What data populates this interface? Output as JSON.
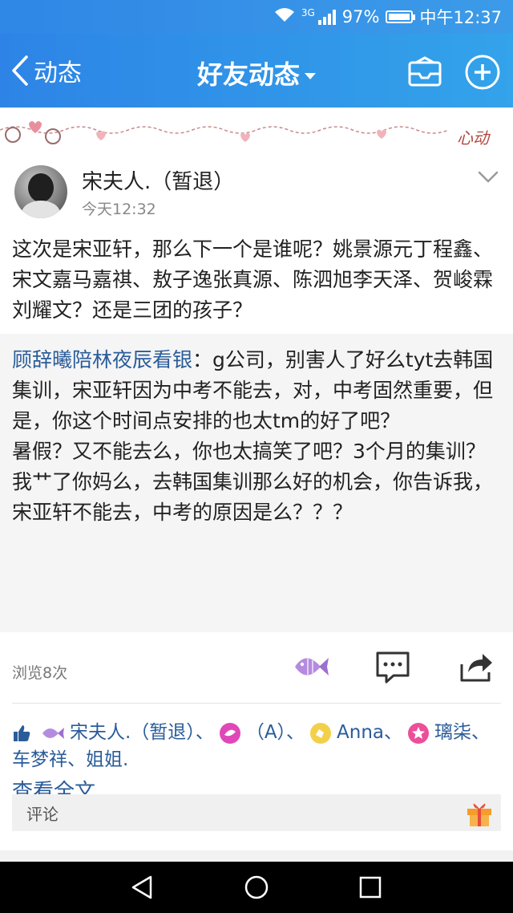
{
  "status_bar": {
    "network": "3G",
    "battery_text": "97%",
    "battery_level": 0.97,
    "time": "中午12:37"
  },
  "nav": {
    "back_label": "动态",
    "title": "好友动态"
  },
  "banner": {
    "text": "心动"
  },
  "post": {
    "author": "宋夫人.（暂退）",
    "time": "今天12:32",
    "content": "这次是宋亚轩，那么下一个是谁呢？姚景源元丁程鑫、宋文嘉马嘉祺、敖子逸张真源、陈泗旭李天泽、贺峻霖刘耀文？还是三团的孩子？",
    "repost": {
      "author": "顾辞曦陪林夜辰看银",
      "text": "：g公司，别害人了好么tyt去韩国集训，宋亚轩因为中考不能去，对，中考固然重要，但是，你这个时间点安排的也太tm的好了吧？\n暑假？又不能去么，你也太搞笑了吧？3个月的集训？我艹了你妈么，去韩国集训那么好的机会，你告诉我，宋亚轩不能去，中考的原因是么？？？"
    },
    "read_more": "查看全文",
    "views": "浏览8次"
  },
  "likes": {
    "names": [
      "宋夫人.（暂退）",
      "（A）",
      "Anna",
      "璃柒",
      "车梦祥",
      "姐姐."
    ],
    "separator": "、"
  },
  "comment": {
    "placeholder": "评论"
  },
  "colors": {
    "accent": "#2f87e6",
    "link": "#2a5c9a"
  }
}
